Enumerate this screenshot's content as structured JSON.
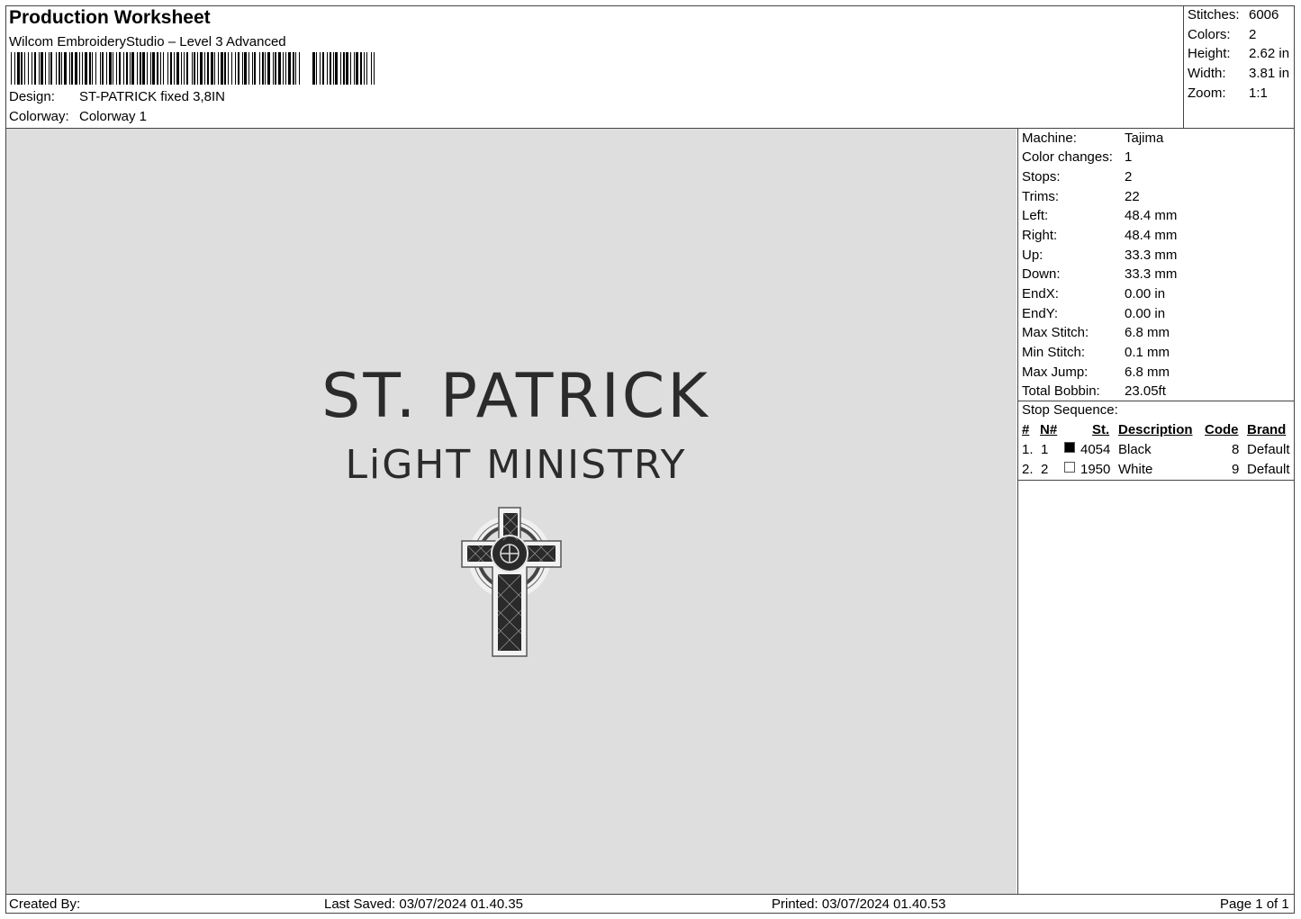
{
  "header": {
    "title": "Production Worksheet",
    "subtitle": "Wilcom EmbroideryStudio – Level 3 Advanced",
    "design_label": "Design:",
    "design_value": "ST-PATRICK fixed 3,8IN",
    "colorway_label": "Colorway:",
    "colorway_value": "Colorway 1"
  },
  "stats": {
    "stitches_label": "Stitches:",
    "stitches": "6006",
    "colors_label": "Colors:",
    "colors": "2",
    "height_label": "Height:",
    "height": "2.62 in",
    "width_label": "Width:",
    "width": "3.81 in",
    "zoom_label": "Zoom:",
    "zoom": "1:1"
  },
  "design_preview": {
    "line1": "ST. PATRICK",
    "line2": "LiGHT MINISTRY",
    "background": "#dedede",
    "thread_color": "#2b2b2b"
  },
  "machine": {
    "rows": [
      {
        "label": "Machine:",
        "value": "Tajima"
      },
      {
        "label": "Color changes:",
        "value": "1"
      },
      {
        "label": "Stops:",
        "value": "2"
      },
      {
        "label": "Trims:",
        "value": "22"
      },
      {
        "label": "Left:",
        "value": "48.4 mm"
      },
      {
        "label": "Right:",
        "value": "48.4 mm"
      },
      {
        "label": "Up:",
        "value": "33.3 mm"
      },
      {
        "label": "Down:",
        "value": "33.3 mm"
      },
      {
        "label": "EndX:",
        "value": "0.00 in"
      },
      {
        "label": "EndY:",
        "value": "0.00 in"
      },
      {
        "label": "Max Stitch:",
        "value": "6.8 mm"
      },
      {
        "label": "Min Stitch:",
        "value": "0.1 mm"
      },
      {
        "label": "Max Jump:",
        "value": "6.8 mm"
      },
      {
        "label": "Total Bobbin:",
        "value": "23.05ft"
      }
    ]
  },
  "stop_sequence": {
    "title": "Stop Sequence:",
    "headers": {
      "num": "#",
      "n": "N#",
      "st": "St.",
      "description": "Description",
      "code": "Code",
      "brand": "Brand"
    },
    "rows": [
      {
        "num": "1.",
        "n": "1",
        "swatch": "#000000",
        "st": "4054",
        "description": "Black",
        "code": "8",
        "brand": "Default"
      },
      {
        "num": "2.",
        "n": "2",
        "swatch": "#ffffff",
        "st": "1950",
        "description": "White",
        "code": "9",
        "brand": "Default"
      }
    ]
  },
  "footer": {
    "created_by": "Created By:",
    "last_saved": "Last Saved: 03/07/2024 01.40.35",
    "printed": "Printed: 03/07/2024 01.40.53",
    "page": "Page 1 of 1"
  }
}
